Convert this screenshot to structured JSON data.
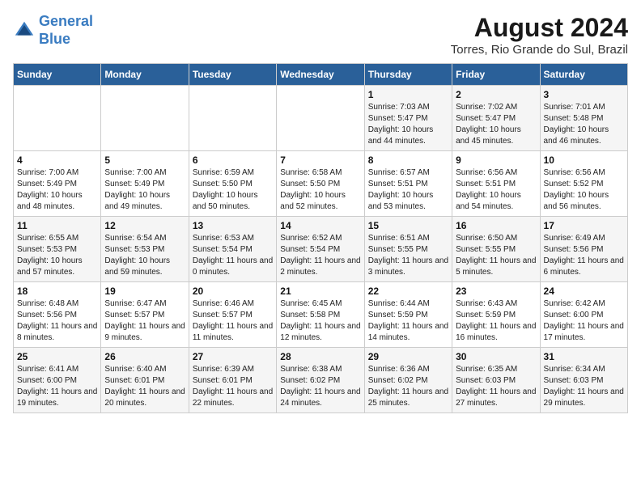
{
  "header": {
    "logo_line1": "General",
    "logo_line2": "Blue",
    "month_year": "August 2024",
    "location": "Torres, Rio Grande do Sul, Brazil"
  },
  "days_of_week": [
    "Sunday",
    "Monday",
    "Tuesday",
    "Wednesday",
    "Thursday",
    "Friday",
    "Saturday"
  ],
  "weeks": [
    [
      {
        "day": "",
        "sunrise": "",
        "sunset": "",
        "daylight": ""
      },
      {
        "day": "",
        "sunrise": "",
        "sunset": "",
        "daylight": ""
      },
      {
        "day": "",
        "sunrise": "",
        "sunset": "",
        "daylight": ""
      },
      {
        "day": "",
        "sunrise": "",
        "sunset": "",
        "daylight": ""
      },
      {
        "day": "1",
        "sunrise": "Sunrise: 7:03 AM",
        "sunset": "Sunset: 5:47 PM",
        "daylight": "Daylight: 10 hours and 44 minutes."
      },
      {
        "day": "2",
        "sunrise": "Sunrise: 7:02 AM",
        "sunset": "Sunset: 5:47 PM",
        "daylight": "Daylight: 10 hours and 45 minutes."
      },
      {
        "day": "3",
        "sunrise": "Sunrise: 7:01 AM",
        "sunset": "Sunset: 5:48 PM",
        "daylight": "Daylight: 10 hours and 46 minutes."
      }
    ],
    [
      {
        "day": "4",
        "sunrise": "Sunrise: 7:00 AM",
        "sunset": "Sunset: 5:49 PM",
        "daylight": "Daylight: 10 hours and 48 minutes."
      },
      {
        "day": "5",
        "sunrise": "Sunrise: 7:00 AM",
        "sunset": "Sunset: 5:49 PM",
        "daylight": "Daylight: 10 hours and 49 minutes."
      },
      {
        "day": "6",
        "sunrise": "Sunrise: 6:59 AM",
        "sunset": "Sunset: 5:50 PM",
        "daylight": "Daylight: 10 hours and 50 minutes."
      },
      {
        "day": "7",
        "sunrise": "Sunrise: 6:58 AM",
        "sunset": "Sunset: 5:50 PM",
        "daylight": "Daylight: 10 hours and 52 minutes."
      },
      {
        "day": "8",
        "sunrise": "Sunrise: 6:57 AM",
        "sunset": "Sunset: 5:51 PM",
        "daylight": "Daylight: 10 hours and 53 minutes."
      },
      {
        "day": "9",
        "sunrise": "Sunrise: 6:56 AM",
        "sunset": "Sunset: 5:51 PM",
        "daylight": "Daylight: 10 hours and 54 minutes."
      },
      {
        "day": "10",
        "sunrise": "Sunrise: 6:56 AM",
        "sunset": "Sunset: 5:52 PM",
        "daylight": "Daylight: 10 hours and 56 minutes."
      }
    ],
    [
      {
        "day": "11",
        "sunrise": "Sunrise: 6:55 AM",
        "sunset": "Sunset: 5:53 PM",
        "daylight": "Daylight: 10 hours and 57 minutes."
      },
      {
        "day": "12",
        "sunrise": "Sunrise: 6:54 AM",
        "sunset": "Sunset: 5:53 PM",
        "daylight": "Daylight: 10 hours and 59 minutes."
      },
      {
        "day": "13",
        "sunrise": "Sunrise: 6:53 AM",
        "sunset": "Sunset: 5:54 PM",
        "daylight": "Daylight: 11 hours and 0 minutes."
      },
      {
        "day": "14",
        "sunrise": "Sunrise: 6:52 AM",
        "sunset": "Sunset: 5:54 PM",
        "daylight": "Daylight: 11 hours and 2 minutes."
      },
      {
        "day": "15",
        "sunrise": "Sunrise: 6:51 AM",
        "sunset": "Sunset: 5:55 PM",
        "daylight": "Daylight: 11 hours and 3 minutes."
      },
      {
        "day": "16",
        "sunrise": "Sunrise: 6:50 AM",
        "sunset": "Sunset: 5:55 PM",
        "daylight": "Daylight: 11 hours and 5 minutes."
      },
      {
        "day": "17",
        "sunrise": "Sunrise: 6:49 AM",
        "sunset": "Sunset: 5:56 PM",
        "daylight": "Daylight: 11 hours and 6 minutes."
      }
    ],
    [
      {
        "day": "18",
        "sunrise": "Sunrise: 6:48 AM",
        "sunset": "Sunset: 5:56 PM",
        "daylight": "Daylight: 11 hours and 8 minutes."
      },
      {
        "day": "19",
        "sunrise": "Sunrise: 6:47 AM",
        "sunset": "Sunset: 5:57 PM",
        "daylight": "Daylight: 11 hours and 9 minutes."
      },
      {
        "day": "20",
        "sunrise": "Sunrise: 6:46 AM",
        "sunset": "Sunset: 5:57 PM",
        "daylight": "Daylight: 11 hours and 11 minutes."
      },
      {
        "day": "21",
        "sunrise": "Sunrise: 6:45 AM",
        "sunset": "Sunset: 5:58 PM",
        "daylight": "Daylight: 11 hours and 12 minutes."
      },
      {
        "day": "22",
        "sunrise": "Sunrise: 6:44 AM",
        "sunset": "Sunset: 5:59 PM",
        "daylight": "Daylight: 11 hours and 14 minutes."
      },
      {
        "day": "23",
        "sunrise": "Sunrise: 6:43 AM",
        "sunset": "Sunset: 5:59 PM",
        "daylight": "Daylight: 11 hours and 16 minutes."
      },
      {
        "day": "24",
        "sunrise": "Sunrise: 6:42 AM",
        "sunset": "Sunset: 6:00 PM",
        "daylight": "Daylight: 11 hours and 17 minutes."
      }
    ],
    [
      {
        "day": "25",
        "sunrise": "Sunrise: 6:41 AM",
        "sunset": "Sunset: 6:00 PM",
        "daylight": "Daylight: 11 hours and 19 minutes."
      },
      {
        "day": "26",
        "sunrise": "Sunrise: 6:40 AM",
        "sunset": "Sunset: 6:01 PM",
        "daylight": "Daylight: 11 hours and 20 minutes."
      },
      {
        "day": "27",
        "sunrise": "Sunrise: 6:39 AM",
        "sunset": "Sunset: 6:01 PM",
        "daylight": "Daylight: 11 hours and 22 minutes."
      },
      {
        "day": "28",
        "sunrise": "Sunrise: 6:38 AM",
        "sunset": "Sunset: 6:02 PM",
        "daylight": "Daylight: 11 hours and 24 minutes."
      },
      {
        "day": "29",
        "sunrise": "Sunrise: 6:36 AM",
        "sunset": "Sunset: 6:02 PM",
        "daylight": "Daylight: 11 hours and 25 minutes."
      },
      {
        "day": "30",
        "sunrise": "Sunrise: 6:35 AM",
        "sunset": "Sunset: 6:03 PM",
        "daylight": "Daylight: 11 hours and 27 minutes."
      },
      {
        "day": "31",
        "sunrise": "Sunrise: 6:34 AM",
        "sunset": "Sunset: 6:03 PM",
        "daylight": "Daylight: 11 hours and 29 minutes."
      }
    ]
  ]
}
